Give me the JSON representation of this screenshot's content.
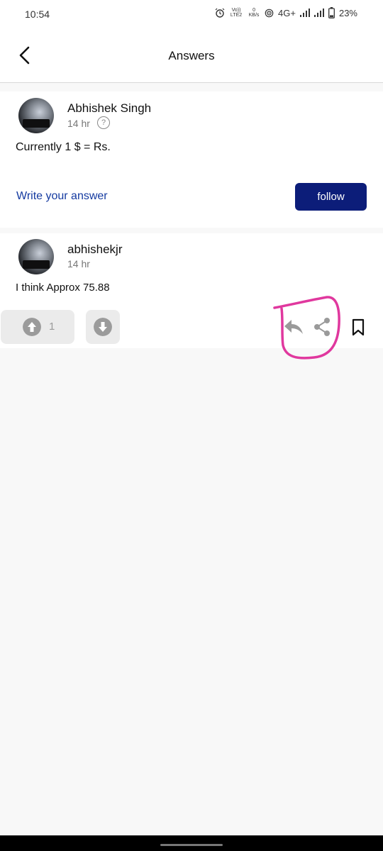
{
  "status_bar": {
    "time": "10:54",
    "volte": "Vo)) LTE2",
    "speed_value": "0",
    "speed_unit": "KB/s",
    "network": "4G+",
    "battery": "23%"
  },
  "header": {
    "title": "Answers"
  },
  "question": {
    "author": "Abhishek Singh",
    "time": "14 hr",
    "text": "Currently 1 $ = Rs.",
    "write_answer_label": "Write your answer",
    "follow_label": "follow"
  },
  "answer": {
    "author": "abhishekjr",
    "time": "14 hr",
    "text": "I think Approx 75.88",
    "upvote_count": "1"
  },
  "colors": {
    "accent_button": "#0c1d79",
    "link": "#143aa0",
    "annotation": "#e0389e"
  },
  "icons": [
    "back-arrow",
    "help-circle",
    "upvote",
    "downvote",
    "reply",
    "share",
    "bookmark"
  ]
}
